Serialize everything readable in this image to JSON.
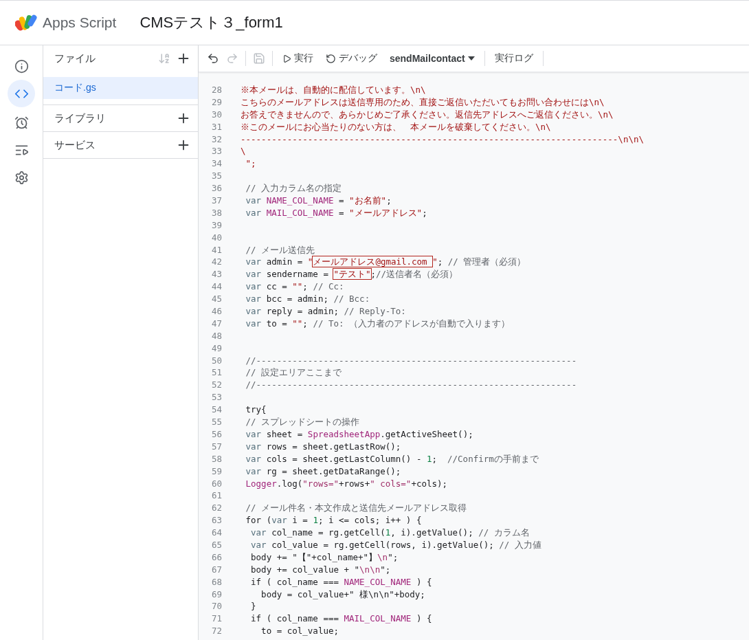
{
  "header": {
    "app_name": "Apps Script",
    "project_title": "CMSテスト３_form1"
  },
  "rail": [
    {
      "kind": "info",
      "selected": false
    },
    {
      "kind": "code",
      "selected": true
    },
    {
      "kind": "triggers",
      "selected": false
    },
    {
      "kind": "executions",
      "selected": false
    },
    {
      "kind": "settings",
      "selected": false
    }
  ],
  "files_panel": {
    "title": "ファイル",
    "files": [
      {
        "name": "コード.gs",
        "selected": true
      }
    ],
    "sections": [
      {
        "title": "ライブラリ"
      },
      {
        "title": "サービス"
      }
    ]
  },
  "toolbar": {
    "undo_disabled": false,
    "redo_disabled": true,
    "save_disabled": true,
    "run": "実行",
    "debug": "デバッグ",
    "function": "sendMailcontact",
    "log": "実行ログ"
  },
  "code_lines": [
    {
      "number": "28",
      "segments": [
        {
          "kind": "str",
          "text": "※本メールは、自動的に配信しています。\\n\\"
        }
      ]
    },
    {
      "number": "29",
      "segments": [
        {
          "kind": "str",
          "text": "こちらのメールアドレスは送信専用のため、直接ご返信いただいてもお問い合わせには\\n\\"
        }
      ]
    },
    {
      "number": "30",
      "segments": [
        {
          "kind": "str",
          "text": "お答えできませんので、あらかじめご了承ください。返信先アドレスへご返信ください。\\n\\"
        }
      ]
    },
    {
      "number": "31",
      "segments": [
        {
          "kind": "str",
          "text": "※このメールにお心当たりのない方は、　本メールを破棄してください。\\n\\"
        }
      ]
    },
    {
      "number": "32",
      "segments": [
        {
          "kind": "str",
          "text": "-------------------------------------------------------------------------\\n\\n\\"
        }
      ]
    },
    {
      "number": "33",
      "segments": [
        {
          "kind": "str",
          "text": "\\"
        }
      ]
    },
    {
      "number": "34",
      "segments": [
        {
          "kind": "str",
          "text": " \";"
        }
      ]
    },
    {
      "number": "35"
    },
    {
      "number": "36",
      "segments": [
        {
          "kind": "cmt",
          "text": " // 入力カラム名の指定"
        }
      ]
    },
    {
      "number": "37",
      "segments": [
        {
          "kind": "kw",
          "text": " var "
        },
        {
          "kind": "const",
          "text": "NAME_COL_NAME"
        },
        {
          "kind": "id",
          "text": " = "
        },
        {
          "kind": "str",
          "text": "\"お名前\""
        },
        {
          "kind": "id",
          "text": ";"
        }
      ]
    },
    {
      "number": "38",
      "segments": [
        {
          "kind": "kw",
          "text": " var "
        },
        {
          "kind": "const",
          "text": "MAIL_COL_NAME"
        },
        {
          "kind": "id",
          "text": " = "
        },
        {
          "kind": "str",
          "text": "\"メールアドレス\""
        },
        {
          "kind": "id",
          "text": ";"
        }
      ]
    },
    {
      "number": "39"
    },
    {
      "number": "40"
    },
    {
      "number": "41",
      "segments": [
        {
          "kind": "cmt",
          "text": " // メール送信先"
        }
      ]
    },
    {
      "number": "42",
      "segments": [
        {
          "kind": "kw",
          "text": " var "
        },
        {
          "kind": "id",
          "text": "admin = "
        },
        {
          "kind": "str",
          "text": "\""
        },
        {
          "kind": "str",
          "text": "メールアドレス@gmail.com ",
          "boxed": true
        },
        {
          "kind": "str",
          "text": "\""
        },
        {
          "kind": "id",
          "text": "; "
        },
        {
          "kind": "cmt",
          "text": "// 管理者（必須）"
        }
      ]
    },
    {
      "number": "43",
      "segments": [
        {
          "kind": "kw",
          "text": " var "
        },
        {
          "kind": "id",
          "text": "sendername = "
        },
        {
          "kind": "str",
          "text": "\"テスト\"",
          "boxed": true
        },
        {
          "kind": "id",
          "text": ";"
        },
        {
          "kind": "cmt",
          "text": "//送信者名（必須）"
        }
      ]
    },
    {
      "number": "44",
      "segments": [
        {
          "kind": "kw",
          "text": " var "
        },
        {
          "kind": "id",
          "text": "cc = "
        },
        {
          "kind": "str",
          "text": "\"\""
        },
        {
          "kind": "id",
          "text": "; "
        },
        {
          "kind": "cmt",
          "text": "// Cc:"
        }
      ]
    },
    {
      "number": "45",
      "segments": [
        {
          "kind": "kw",
          "text": " var "
        },
        {
          "kind": "id",
          "text": "bcc = admin; "
        },
        {
          "kind": "cmt",
          "text": "// Bcc:"
        }
      ]
    },
    {
      "number": "46",
      "segments": [
        {
          "kind": "kw",
          "text": " var "
        },
        {
          "kind": "id",
          "text": "reply = admin; "
        },
        {
          "kind": "cmt",
          "text": "// Reply-To:"
        }
      ]
    },
    {
      "number": "47",
      "segments": [
        {
          "kind": "kw",
          "text": " var "
        },
        {
          "kind": "id",
          "text": "to = "
        },
        {
          "kind": "str",
          "text": "\"\""
        },
        {
          "kind": "id",
          "text": "; "
        },
        {
          "kind": "cmt",
          "text": "// To: （入力者のアドレスが自動で入ります）"
        }
      ]
    },
    {
      "number": "48"
    },
    {
      "number": "49"
    },
    {
      "number": "50",
      "segments": [
        {
          "kind": "cmt",
          "text": " //--------------------------------------------------------------"
        }
      ]
    },
    {
      "number": "51",
      "segments": [
        {
          "kind": "cmt",
          "text": " // 設定エリアここまで"
        }
      ]
    },
    {
      "number": "52",
      "segments": [
        {
          "kind": "cmt",
          "text": " //--------------------------------------------------------------"
        }
      ]
    },
    {
      "number": "53"
    },
    {
      "number": "54",
      "segments": [
        {
          "kind": "id",
          "text": " try{"
        }
      ]
    },
    {
      "number": "55",
      "segments": [
        {
          "kind": "cmt",
          "text": " // スプレッドシートの操作"
        }
      ]
    },
    {
      "number": "56",
      "segments": [
        {
          "kind": "kw",
          "text": " var "
        },
        {
          "kind": "id",
          "text": "sheet = "
        },
        {
          "kind": "const",
          "text": "SpreadsheetApp"
        },
        {
          "kind": "id",
          "text": ".getActiveSheet();"
        }
      ]
    },
    {
      "number": "57",
      "segments": [
        {
          "kind": "kw",
          "text": " var "
        },
        {
          "kind": "id",
          "text": "rows = sheet.getLastRow();"
        }
      ]
    },
    {
      "number": "58",
      "segments": [
        {
          "kind": "kw",
          "text": " var "
        },
        {
          "kind": "id",
          "text": "cols = sheet.getLastColumn() - "
        },
        {
          "kind": "num",
          "text": "1"
        },
        {
          "kind": "id",
          "text": ";  "
        },
        {
          "kind": "cmt",
          "text": "//Confirmの手前まで"
        }
      ]
    },
    {
      "number": "59",
      "segments": [
        {
          "kind": "kw",
          "text": " var "
        },
        {
          "kind": "id",
          "text": "rg = sheet.getDataRange();"
        }
      ]
    },
    {
      "number": "60",
      "segments": [
        {
          "kind": "const",
          "text": " Logger"
        },
        {
          "kind": "id",
          "text": ".log("
        },
        {
          "kind": "str2",
          "text": "\"rows=\""
        },
        {
          "kind": "id",
          "text": "+rows+"
        },
        {
          "kind": "str2",
          "text": "\" cols=\""
        },
        {
          "kind": "id",
          "text": "+cols);"
        }
      ]
    },
    {
      "number": "61"
    },
    {
      "number": "62",
      "segments": [
        {
          "kind": "cmt",
          "text": " // メール件名・本文作成と送信先メールアドレス取得"
        }
      ]
    },
    {
      "number": "63",
      "segments": [
        {
          "kind": "id",
          "text": " for ("
        },
        {
          "kind": "kw",
          "text": "var "
        },
        {
          "kind": "id",
          "text": "i = "
        },
        {
          "kind": "num",
          "text": "1"
        },
        {
          "kind": "id",
          "text": "; i <= cols; i++ ) {"
        }
      ]
    },
    {
      "number": "64",
      "segments": [
        {
          "kind": "kw",
          "text": "  var "
        },
        {
          "kind": "id",
          "text": "col_name = rg.getCell("
        },
        {
          "kind": "num",
          "text": "1"
        },
        {
          "kind": "id",
          "text": ", i).getValue(); "
        },
        {
          "kind": "cmt",
          "text": "// カラム名"
        }
      ]
    },
    {
      "number": "65",
      "segments": [
        {
          "kind": "kw",
          "text": "  var "
        },
        {
          "kind": "id",
          "text": "col_value = rg.getCell(rows, i).getValue(); "
        },
        {
          "kind": "cmt",
          "text": "// 入力値"
        }
      ]
    },
    {
      "number": "66",
      "segments": [
        {
          "kind": "id",
          "text": "  body += \"【\"+col_name+\"】"
        },
        {
          "kind": "str2",
          "text": "\\n"
        },
        {
          "kind": "id",
          "text": "\";"
        }
      ]
    },
    {
      "number": "67",
      "segments": [
        {
          "kind": "id",
          "text": "  body += col_value + \""
        },
        {
          "kind": "str2",
          "text": "\\n\\n"
        },
        {
          "kind": "id",
          "text": "\";"
        }
      ]
    },
    {
      "number": "68",
      "segments": [
        {
          "kind": "id",
          "text": "  if ( col_name === "
        },
        {
          "kind": "const",
          "text": "NAME_COL_NAME"
        },
        {
          "kind": "id",
          "text": " ) {"
        }
      ]
    },
    {
      "number": "69",
      "segments": [
        {
          "kind": "id",
          "text": "    body = col_value+\" 様\\n\\n\"+body;"
        }
      ]
    },
    {
      "number": "70",
      "segments": [
        {
          "kind": "id",
          "text": "  }"
        }
      ]
    },
    {
      "number": "71",
      "segments": [
        {
          "kind": "id",
          "text": "  if ( col_name === "
        },
        {
          "kind": "const",
          "text": "MAIL_COL_NAME"
        },
        {
          "kind": "id",
          "text": " ) {"
        }
      ]
    },
    {
      "number": "72",
      "segments": [
        {
          "kind": "id",
          "text": "    to = col_value;"
        }
      ]
    }
  ]
}
